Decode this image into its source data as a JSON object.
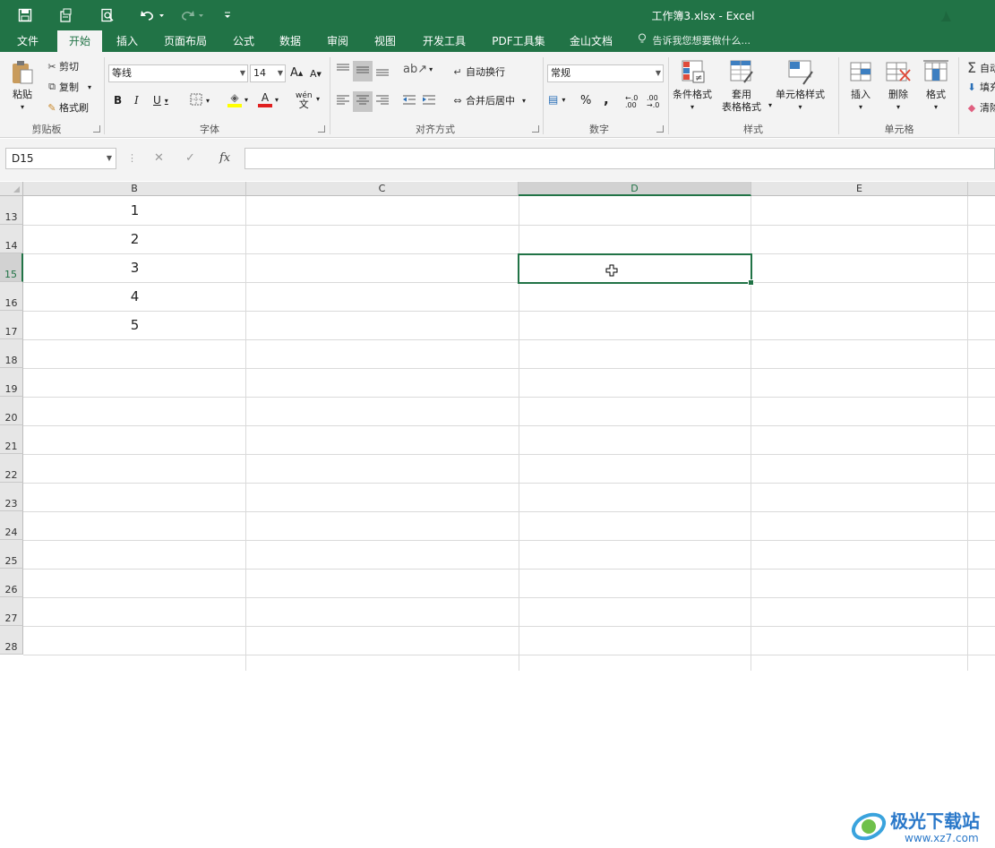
{
  "window": {
    "title": "工作簿3.xlsx - Excel"
  },
  "tabs": [
    {
      "label": "文件"
    },
    {
      "label": "开始"
    },
    {
      "label": "插入"
    },
    {
      "label": "页面布局"
    },
    {
      "label": "公式"
    },
    {
      "label": "数据"
    },
    {
      "label": "审阅"
    },
    {
      "label": "视图"
    },
    {
      "label": "开发工具"
    },
    {
      "label": "PDF工具集"
    },
    {
      "label": "金山文档"
    }
  ],
  "tell_me": "告诉我您想要做什么...",
  "ribbon": {
    "clipboard": {
      "paste": "粘贴",
      "cut": "剪切",
      "copy": "复制",
      "format_painter": "格式刷",
      "label": "剪贴板"
    },
    "font": {
      "name": "等线",
      "size": "14",
      "label": "字体",
      "grow": "A",
      "shrink": "A",
      "bold": "B",
      "italic": "I",
      "underline": "U",
      "phonetic": "wén",
      "font_color": "A"
    },
    "alignment": {
      "wrap": "自动换行",
      "merge": "合并后居中",
      "label": "对齐方式"
    },
    "number": {
      "format": "常规",
      "percent": "%",
      "comma": ",",
      "inc": "←.0 .00",
      "dec": ".00 →.0",
      "label": "数字"
    },
    "styles": {
      "conditional": "条件格式",
      "table_a": "套用",
      "table_b": "表格格式",
      "cell_styles": "单元格样式",
      "label": "样式"
    },
    "cells": {
      "insert": "插入",
      "delete": "删除",
      "format": "格式",
      "label": "单元格"
    },
    "editing": {
      "autosum": "自动",
      "fill": "填充",
      "clear": "清除"
    }
  },
  "formula_bar": {
    "name_box": "D15",
    "cancel": "✕",
    "enter": "✓",
    "fx": "fx",
    "content": ""
  },
  "columns": [
    {
      "label": ""
    },
    {
      "label": "B"
    },
    {
      "label": "C"
    },
    {
      "label": "D"
    },
    {
      "label": "E"
    }
  ],
  "rows": [
    {
      "num": "13",
      "b": "1"
    },
    {
      "num": "14",
      "b": "2"
    },
    {
      "num": "15",
      "b": "3"
    },
    {
      "num": "16",
      "b": "4"
    },
    {
      "num": "17",
      "b": "5"
    },
    {
      "num": "18",
      "b": ""
    },
    {
      "num": "19",
      "b": ""
    },
    {
      "num": "20",
      "b": ""
    },
    {
      "num": "21",
      "b": ""
    },
    {
      "num": "22",
      "b": ""
    },
    {
      "num": "23",
      "b": ""
    },
    {
      "num": "24",
      "b": ""
    },
    {
      "num": "25",
      "b": ""
    },
    {
      "num": "26",
      "b": ""
    },
    {
      "num": "27",
      "b": ""
    },
    {
      "num": "28",
      "b": ""
    }
  ],
  "selected_cell": "D15",
  "watermark": {
    "brand": "极光下载站",
    "url": "www.xz7.com"
  },
  "colors": {
    "accent": "#217346",
    "ribbon_bg": "#f3f3f3",
    "grid": "#dadada"
  }
}
